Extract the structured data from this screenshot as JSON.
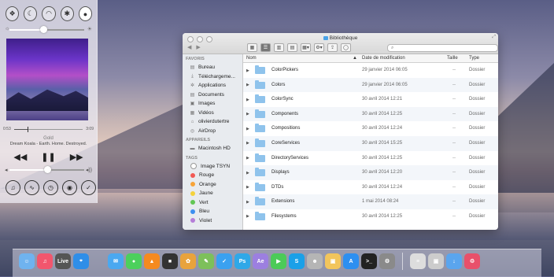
{
  "control_center": {
    "toggles": [
      {
        "name": "do-not-disturb-icon",
        "glyph": "❖",
        "on": false
      },
      {
        "name": "moon-icon",
        "glyph": "☾",
        "on": false
      },
      {
        "name": "wifi-icon",
        "glyph": "◠",
        "on": false
      },
      {
        "name": "bluetooth-icon",
        "glyph": "✱",
        "on": false
      },
      {
        "name": "brightness-icon",
        "glyph": "●",
        "on": true
      }
    ],
    "brightness_level": 0.45,
    "progress": {
      "elapsed": "0:53",
      "remaining": "3:09",
      "fraction": 0.2
    },
    "song_title": "Gold",
    "artist": "Dream Koala - Earth. Home. Destroyed.",
    "transport": {
      "prev": "◀◀",
      "play": "❚❚",
      "next": "▶▶"
    },
    "volume_level": 0.5,
    "bottom_buttons": [
      {
        "name": "airplay-icon",
        "glyph": "♫"
      },
      {
        "name": "airdrop-icon",
        "glyph": "∿"
      },
      {
        "name": "timer-icon",
        "glyph": "◷"
      },
      {
        "name": "camera-icon",
        "glyph": "◉"
      },
      {
        "name": "checkmark-icon",
        "glyph": "✓"
      }
    ]
  },
  "finder": {
    "title": "Bibliothèque",
    "search_placeholder": "",
    "sidebar": {
      "favorites_header": "FAVORIS",
      "favorites": [
        {
          "label": "Bureau",
          "icon": "▤"
        },
        {
          "label": "Téléchargeme...",
          "icon": "⤓"
        },
        {
          "label": "Applications",
          "icon": "✲"
        },
        {
          "label": "Documents",
          "icon": "▤"
        },
        {
          "label": "Images",
          "icon": "▣"
        },
        {
          "label": "Vidéos",
          "icon": "▦"
        },
        {
          "label": "olivierdutertre",
          "icon": "⌂"
        },
        {
          "label": "AirDrop",
          "icon": "◎"
        }
      ],
      "devices_header": "APPAREILS",
      "devices": [
        {
          "label": "Macintosh HD",
          "icon": "▬"
        }
      ],
      "tags_header": "TAGS",
      "tags": [
        {
          "label": "Image TSYN",
          "color": "#ffffff"
        },
        {
          "label": "Rouge",
          "color": "#f25a55"
        },
        {
          "label": "Orange",
          "color": "#f7a338"
        },
        {
          "label": "Jaune",
          "color": "#f4d23c"
        },
        {
          "label": "Vert",
          "color": "#62c654"
        },
        {
          "label": "Bleu",
          "color": "#3c8ff0"
        },
        {
          "label": "Violet",
          "color": "#b57ed8"
        }
      ]
    },
    "columns": {
      "name": "Nom",
      "date": "Date de modification",
      "size": "Taille",
      "kind": "Type"
    },
    "rows": [
      {
        "name": "ColorPickers",
        "date": "29 janvier 2014 06:05",
        "size": "--",
        "kind": "Dossier"
      },
      {
        "name": "Colors",
        "date": "29 janvier 2014 06:05",
        "size": "--",
        "kind": "Dossier"
      },
      {
        "name": "ColorSync",
        "date": "30 avril 2014 12:21",
        "size": "--",
        "kind": "Dossier"
      },
      {
        "name": "Components",
        "date": "30 avril 2014 12:25",
        "size": "--",
        "kind": "Dossier"
      },
      {
        "name": "Compositions",
        "date": "30 avril 2014 12:24",
        "size": "--",
        "kind": "Dossier"
      },
      {
        "name": "CoreServices",
        "date": "30 avril 2014 15:25",
        "size": "--",
        "kind": "Dossier"
      },
      {
        "name": "DirectoryServices",
        "date": "30 avril 2014 12:25",
        "size": "--",
        "kind": "Dossier"
      },
      {
        "name": "Displays",
        "date": "30 avril 2014 12:20",
        "size": "--",
        "kind": "Dossier"
      },
      {
        "name": "DTDs",
        "date": "30 avril 2014 12:24",
        "size": "--",
        "kind": "Dossier"
      },
      {
        "name": "Extensions",
        "date": "1 mai 2014 08:24",
        "size": "--",
        "kind": "Dossier"
      },
      {
        "name": "Filesystems",
        "date": "30 avril 2014 12:25",
        "size": "--",
        "kind": "Dossier"
      }
    ]
  },
  "dock": {
    "apps": [
      {
        "name": "finder-icon",
        "color": "#6fb3ef",
        "glyph": "☺"
      },
      {
        "name": "music-icon",
        "color": "#f2566d",
        "glyph": "♫"
      },
      {
        "name": "live-icon",
        "color": "#555555",
        "glyph": "Live"
      },
      {
        "name": "safari-icon",
        "color": "#2f8ee8",
        "glyph": "⌖"
      },
      {
        "name": "gap",
        "color": "",
        "glyph": ""
      },
      {
        "name": "mail-icon",
        "color": "#4aa8f0",
        "glyph": "✉"
      },
      {
        "name": "messages-icon",
        "color": "#4cd05c",
        "glyph": "●"
      },
      {
        "name": "vlc-icon",
        "color": "#f58a1f",
        "glyph": "▲"
      },
      {
        "name": "claquette-icon",
        "color": "#333333",
        "glyph": "■"
      },
      {
        "name": "photos-icon",
        "color": "#e8a33c",
        "glyph": "✿"
      },
      {
        "name": "notes-icon",
        "color": "#7dc05a",
        "glyph": "✎"
      },
      {
        "name": "twitter-icon",
        "color": "#3aa1f0",
        "glyph": "✓"
      },
      {
        "name": "photoshop-icon",
        "color": "#2fa8e8",
        "glyph": "Ps"
      },
      {
        "name": "after-effects-icon",
        "color": "#9c7fe0",
        "glyph": "Ae"
      },
      {
        "name": "facetime-icon",
        "color": "#4ccb58",
        "glyph": "▶"
      },
      {
        "name": "skype-icon",
        "color": "#1aa0e8",
        "glyph": "S"
      },
      {
        "name": "contacts-icon",
        "color": "#b5b5b5",
        "glyph": "☻"
      },
      {
        "name": "preview-icon",
        "color": "#f2c55c",
        "glyph": "▣"
      },
      {
        "name": "app-store-icon",
        "color": "#2d8ff0",
        "glyph": "A"
      },
      {
        "name": "terminal-icon",
        "color": "#222222",
        "glyph": ">_"
      },
      {
        "name": "system-preferences-icon",
        "color": "#8a8a8a",
        "glyph": "⚙"
      },
      {
        "name": "sep",
        "color": "",
        "glyph": ""
      },
      {
        "name": "documents-stack-icon",
        "color": "#dddddd",
        "glyph": "≡"
      },
      {
        "name": "screenshots-stack-icon",
        "color": "#cccccc",
        "glyph": "▣"
      },
      {
        "name": "downloads-icon",
        "color": "#5aa5ee",
        "glyph": "↓"
      },
      {
        "name": "trash-icon",
        "color": "#e8506a",
        "glyph": "♲"
      }
    ]
  }
}
